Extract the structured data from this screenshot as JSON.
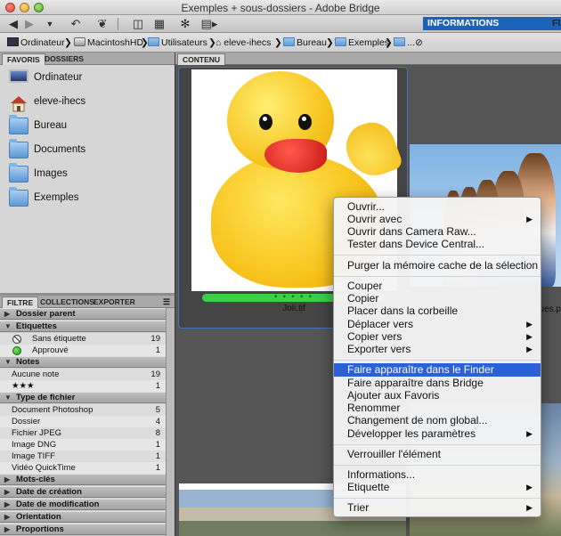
{
  "window": {
    "title": "Exemples + sous-dossiers - Adobe Bridge"
  },
  "toolbar": {
    "workspace_active": "INFORMATIONS ESSENTIELLES",
    "workspace_next": "FIL",
    "icons": [
      "back-icon",
      "forward-icon",
      "recent-dropdown-icon",
      "rotate-left-icon",
      "return-to-photoshop-icon",
      "get-photos-icon",
      "refine-icon",
      "open-in-camera-raw-icon",
      "output-icon"
    ]
  },
  "path": {
    "crumbs": [
      "Ordinateur",
      "MacintoshHD",
      "Utilisateurs",
      "eleve-ihecs",
      "Bureau",
      "Exemples",
      "..."
    ]
  },
  "favorites_panel": {
    "tabs": [
      "FAVORIS",
      "DOSSIERS"
    ],
    "items": [
      "Ordinateur",
      "eleve-ihecs",
      "Bureau",
      "Documents",
      "Images",
      "Exemples"
    ]
  },
  "filter_panel": {
    "tabs": [
      "FILTRE",
      "COLLECTIONS",
      "EXPORTER"
    ],
    "sections": {
      "parent": "Dossier parent",
      "labels": "Etiquettes",
      "label_rows": [
        {
          "label": "Sans étiquette",
          "count": "19"
        },
        {
          "label": "Approuvé",
          "count": "1"
        }
      ],
      "ratings": "Notes",
      "rating_rows": [
        {
          "label": "Aucune note",
          "count": "19"
        },
        {
          "label": "★★★",
          "count": "1"
        }
      ],
      "filetype": "Type de fichier",
      "filetype_rows": [
        {
          "label": "Document Photoshop",
          "count": "5"
        },
        {
          "label": "Dossier",
          "count": "4"
        },
        {
          "label": "Fichier JPEG",
          "count": "8"
        },
        {
          "label": "Image DNG",
          "count": "1"
        },
        {
          "label": "Image TIFF",
          "count": "1"
        },
        {
          "label": "Vidéo QuickTime",
          "count": "1"
        }
      ],
      "keywords": "Mots-clés",
      "created": "Date de création",
      "modified": "Date de modification",
      "orientation": "Orientation",
      "proportions": "Proportions"
    }
  },
  "content": {
    "tab": "CONTENU",
    "thumbnails": [
      {
        "name": "Joli.tif",
        "label_color": "#39d04c",
        "label_marks": "• • • • •"
      },
      {
        "name": "ues.p"
      }
    ]
  },
  "context_menu": {
    "groups": [
      [
        {
          "label": "Ouvrir..."
        },
        {
          "label": "Ouvrir avec",
          "submenu": true
        },
        {
          "label": "Ouvrir dans Camera Raw..."
        },
        {
          "label": "Tester dans Device Central..."
        }
      ],
      [
        {
          "label": "Purger la mémoire cache de la sélection"
        }
      ],
      [
        {
          "label": "Couper"
        },
        {
          "label": "Copier"
        },
        {
          "label": "Placer dans la corbeille"
        },
        {
          "label": "Déplacer vers",
          "submenu": true
        },
        {
          "label": "Copier vers",
          "submenu": true
        },
        {
          "label": "Exporter vers",
          "submenu": true
        }
      ],
      [
        {
          "label": "Faire apparaître dans le Finder",
          "highlighted": true
        },
        {
          "label": "Faire apparaître dans Bridge"
        },
        {
          "label": "Ajouter aux Favoris"
        },
        {
          "label": "Renommer"
        },
        {
          "label": "Changement de nom global..."
        },
        {
          "label": "Développer les paramètres",
          "submenu": true
        }
      ],
      [
        {
          "label": "Verrouiller l'élément"
        }
      ],
      [
        {
          "label": "Informations..."
        },
        {
          "label": "Etiquette",
          "submenu": true
        }
      ],
      [
        {
          "label": "Trier",
          "submenu": true
        }
      ]
    ]
  },
  "colors": {
    "highlight": "#2a60d8",
    "workspace_button": "#1b63b8",
    "selection_border": "#4a72b8"
  }
}
